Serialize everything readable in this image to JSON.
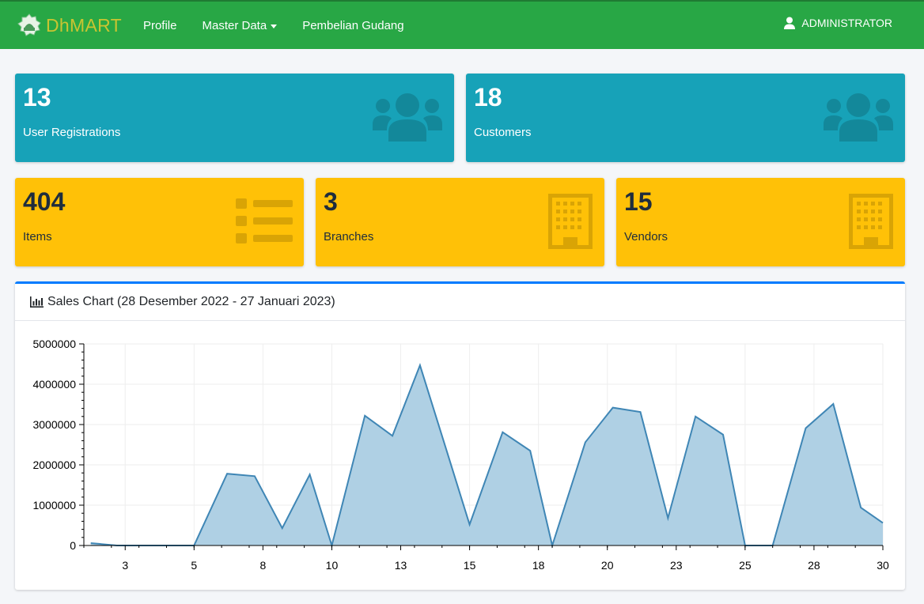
{
  "navbar": {
    "brand": "DhMART",
    "items": [
      {
        "label": "Profile"
      },
      {
        "label": "Master Data",
        "has_dropdown": true
      },
      {
        "label": "Pembelian Gudang"
      }
    ],
    "user": "ADMINISTRATOR",
    "color": "#28a745"
  },
  "stats": {
    "user_registrations": {
      "value": "13",
      "label": "User Registrations",
      "icon": "users-icon"
    },
    "customers": {
      "value": "18",
      "label": "Customers",
      "icon": "users-icon"
    },
    "items": {
      "value": "404",
      "label": "Items",
      "icon": "list-icon"
    },
    "branches": {
      "value": "3",
      "label": "Branches",
      "icon": "building-icon"
    },
    "vendors": {
      "value": "15",
      "label": "Vendors",
      "icon": "building-icon"
    }
  },
  "colors": {
    "info": "#17a2b8",
    "warning": "#ffc107",
    "primary": "#007bff",
    "chart_fill": "#afd0e4",
    "chart_line": "#3f86b5"
  },
  "sales_card": {
    "title": "Sales Chart (28 Desember 2022 - 27 Januari 2023)",
    "icon": "bar-chart-icon"
  },
  "chart_data": {
    "type": "area",
    "x": [
      1.25,
      2.2,
      3.2,
      4.2,
      5.0,
      6.2,
      7.2,
      8.2,
      9.2,
      10.0,
      11.2,
      12.2,
      13.2,
      14.2,
      15.0,
      16.2,
      17.2,
      18.0,
      19.2,
      20.2,
      21.2,
      22.2,
      23.2,
      24.2,
      25.0,
      26.0,
      27.2,
      28.2,
      29.2,
      30.0
    ],
    "values": [
      60000,
      0,
      0,
      0,
      0,
      1780000,
      1720000,
      430000,
      1760000,
      0,
      3220000,
      2720000,
      4470000,
      2280000,
      520000,
      2810000,
      2350000,
      0,
      2560000,
      3420000,
      3310000,
      680000,
      3200000,
      2750000,
      0,
      0,
      2910000,
      3510000,
      940000,
      560000
    ],
    "xticks": [
      "3",
      "5",
      "8",
      "10",
      "13",
      "15",
      "18",
      "20",
      "23",
      "25",
      "28",
      "30"
    ],
    "xtick_values": [
      2.5,
      5,
      7.5,
      10,
      12.5,
      15,
      17.5,
      20,
      22.5,
      25,
      27.5,
      30
    ],
    "yticks": [
      "0",
      "1000000",
      "2000000",
      "3000000",
      "4000000",
      "5000000"
    ],
    "ytick_values": [
      0,
      1000000,
      2000000,
      3000000,
      4000000,
      5000000
    ],
    "xlim": [
      1,
      30
    ],
    "ylim": [
      0,
      5000000
    ],
    "grid": true,
    "title": "Sales Chart (28 Desember 2022 - 27 Januari 2023)"
  }
}
